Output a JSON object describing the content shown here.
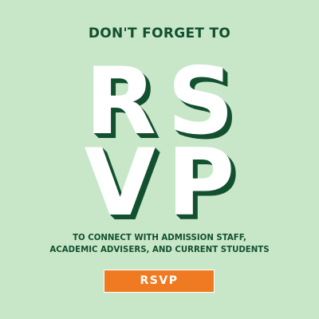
{
  "colors": {
    "background": "#c8e7c9",
    "dark_green": "#12502f",
    "button": "#f07a22",
    "headline_fill": "#ffffff"
  },
  "header": {
    "eyebrow": "DON'T FORGET TO"
  },
  "headline": {
    "line1": "RS",
    "line2": "VP"
  },
  "subtitle": {
    "line1": "TO CONNECT WITH ADMISSION STAFF,",
    "line2": "ACADEMIC ADVISERS, AND CURRENT STUDENTS"
  },
  "cta": {
    "label": "RSVP"
  }
}
